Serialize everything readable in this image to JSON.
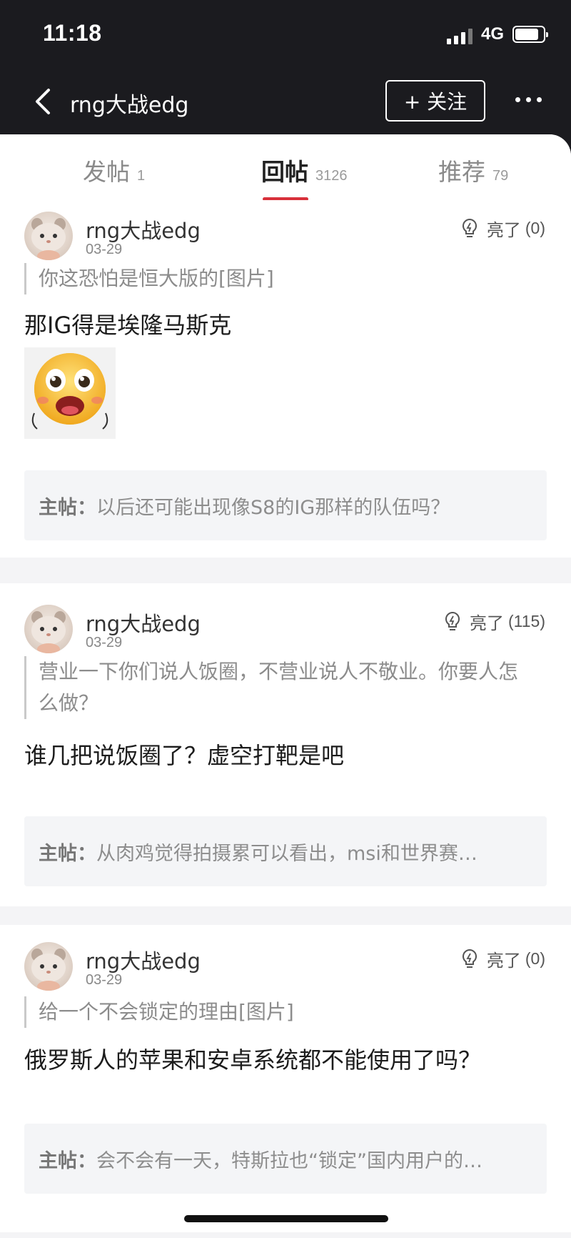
{
  "status_bar": {
    "time": "11:18",
    "network": "4G"
  },
  "header": {
    "title": "rng大战edg",
    "follow_label": "+ 关注"
  },
  "tabs": [
    {
      "label": "发帖",
      "count": "1"
    },
    {
      "label": "回帖",
      "count": "3126",
      "active": true
    },
    {
      "label": "推荐",
      "count": "79"
    }
  ],
  "posts": [
    {
      "username": "rng大战edg",
      "date": "03-29",
      "like_label": "亮了",
      "like_count": "(0)",
      "quote": "你这恐怕是恒大版的[图片]",
      "reply": "那IG得是埃隆马斯克",
      "main_post_label": "主帖：",
      "main_post_text": "以后还可能出现像S8的IG那样的队伍吗？"
    },
    {
      "username": "rng大战edg",
      "date": "03-29",
      "like_label": "亮了",
      "like_count": "(115)",
      "quote": "营业一下你们说人饭圈，不营业说人不敬业。你要人怎么做？",
      "reply": "谁几把说饭圈了？虚空打靶是吧",
      "main_post_label": "主帖：",
      "main_post_text": "从肉鸡觉得拍摄累可以看出，msi和世界赛…"
    },
    {
      "username": "rng大战edg",
      "date": "03-29",
      "like_label": "亮了",
      "like_count": "(0)",
      "quote": "给一个不会锁定的理由[图片]",
      "reply": "俄罗斯人的苹果和安卓系统都不能使用了吗？",
      "main_post_label": "主帖：",
      "main_post_text": "会不会有一天，特斯拉也“锁定”国内用户的…"
    }
  ],
  "icons": {
    "back": "chevron-left-icon",
    "more": "more-dots-icon",
    "like": "lightbulb-icon",
    "signal": "signal-icon",
    "battery": "battery-icon"
  },
  "colors": {
    "accent": "#d8303a",
    "header_bg": "#1b1b1f",
    "page_bg": "#f4f4f6"
  }
}
